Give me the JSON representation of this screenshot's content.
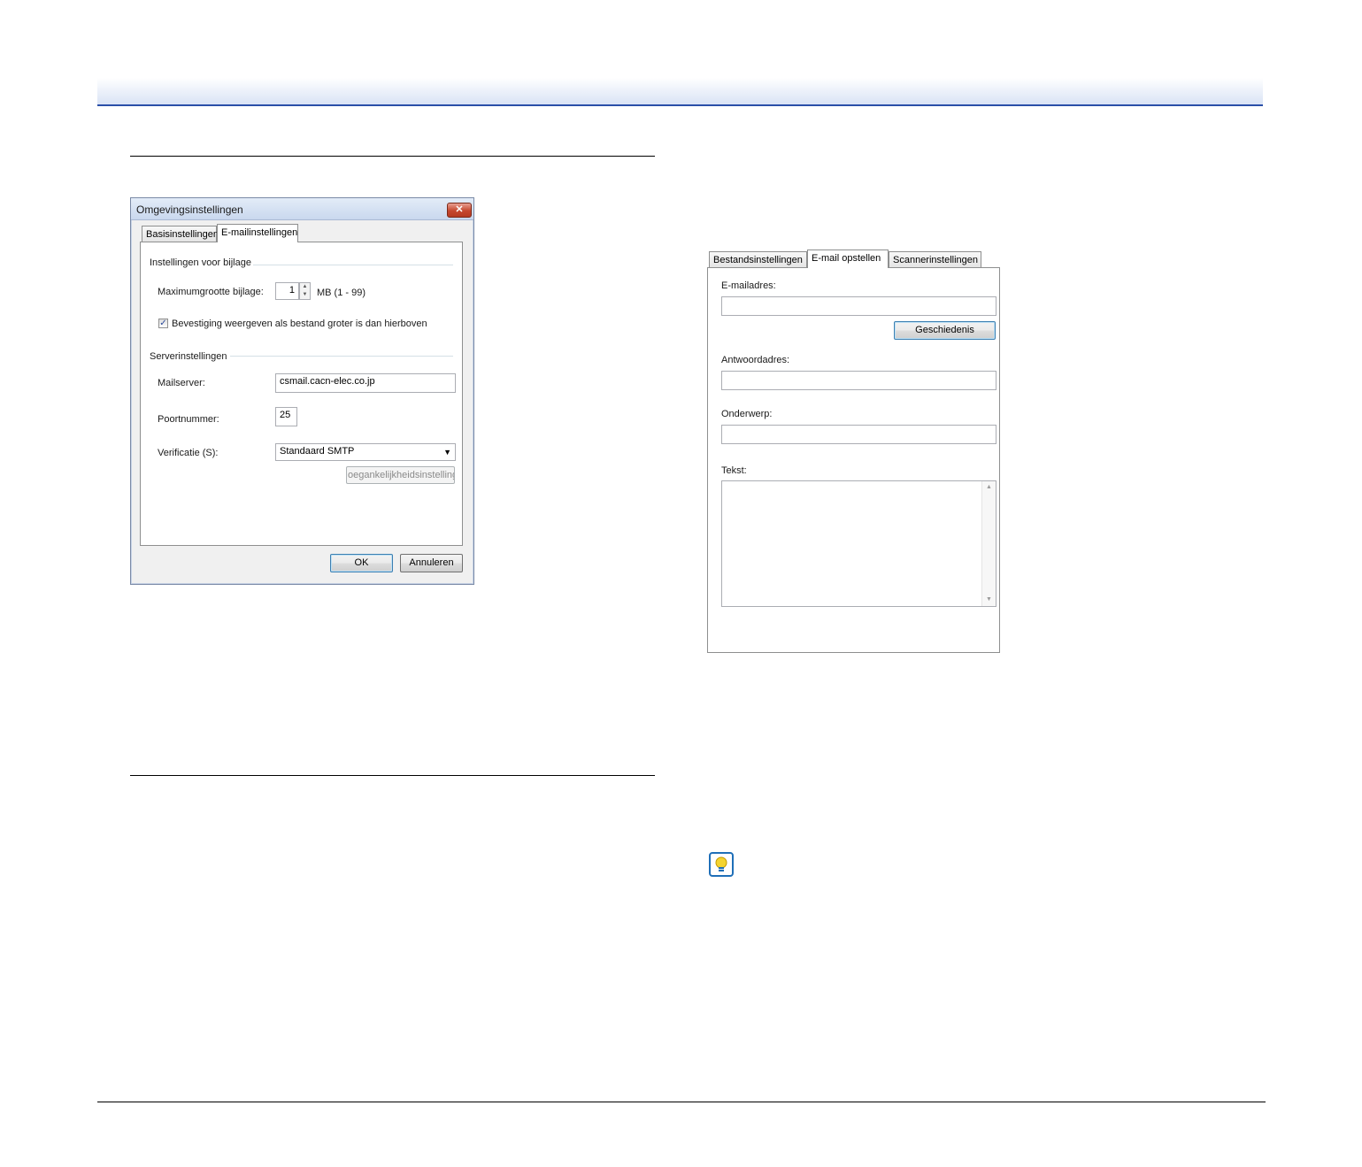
{
  "dialog1": {
    "title": "Omgevingsinstellingen",
    "close_glyph": "✕",
    "tabs": [
      {
        "label": "Basisinstellingen",
        "active": false
      },
      {
        "label": "E-mailinstellingen",
        "active": true
      }
    ],
    "attachment_group": {
      "title": "Instellingen voor bijlage",
      "max_size_label": "Maximumgrootte bijlage:",
      "max_size_value": "1",
      "max_size_unit": "MB (1 - 99)",
      "confirm_checkbox_label": "Bevestiging weergeven als bestand groter is dan hierboven",
      "confirm_checked": true
    },
    "server_group": {
      "title": "Serverinstellingen",
      "mailserver_label": "Mailserver:",
      "mailserver_value": "csmail.cacn-elec.co.jp",
      "port_label": "Poortnummer:",
      "port_value": "25",
      "verification_label": "Verificatie (S):",
      "verification_value": "Standaard SMTP",
      "security_button": "oegankelijkheidsinstellinge"
    },
    "ok_button": "OK",
    "cancel_button": "Annuleren"
  },
  "dialog2": {
    "tabs": [
      {
        "label": "Bestandsinstellingen",
        "active": false
      },
      {
        "label": "E-mail opstellen",
        "active": true
      },
      {
        "label": "Scannerinstellingen",
        "active": false
      }
    ],
    "email_label": "E-mailadres:",
    "email_value": "",
    "history_button": "Geschiedenis",
    "reply_label": "Antwoordadres:",
    "reply_value": "",
    "subject_label": "Onderwerp:",
    "subject_value": "",
    "body_label": "Tekst:",
    "body_value": ""
  },
  "colors": {
    "header_rule": "#2a4fa8",
    "tip_icon": "#1f6fb8"
  }
}
